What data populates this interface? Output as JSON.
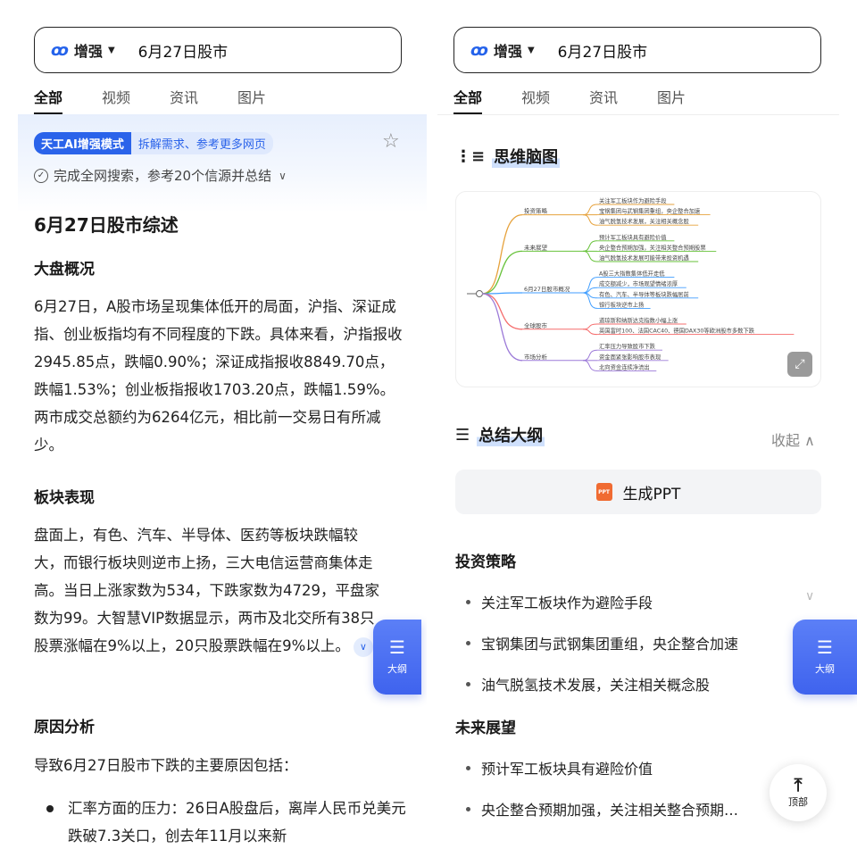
{
  "search": {
    "mode_label": "增强",
    "mode_icon": "ai-logo-icon",
    "query": "6月27日股市"
  },
  "tabs": [
    "全部",
    "视频",
    "资讯",
    "图片"
  ],
  "left": {
    "ai_badge": "天工AI增强模式",
    "ai_desc": "拆解需求、参考更多网页",
    "done_text": "完成全网搜索，参考20个信源并总结",
    "title": "6月27日股市综述",
    "sections": [
      {
        "heading": "大盘概况",
        "text": "6月27日，A股市场呈现集体低开的局面，沪指、深证成指、创业板指均有不同程度的下跌。具体来看，沪指报收2945.85点，跌幅0.90%；深证成指报收8849.70点，跌幅1.53%；创业板指报收1703.20点，跌幅1.59%。两市成交总额约为6264亿元，相比前一交易日有所减少。"
      },
      {
        "heading": "板块表现",
        "text": "盘面上，有色、汽车、半导体、医药等板块跌幅较大，而银行板块则逆市上扬，三大电信运营商集体走高。当日上涨家数为534，下跌家数为4729，平盘家数为99。大智慧VIP数据显示，两市及北交所有38只股票涨幅在9%以上，20只股票跌幅在9%以上。"
      },
      {
        "heading": "原因分析",
        "text": "导致6月27日股市下跌的主要原因包括："
      }
    ],
    "bullet": "汇率方面的压力：26日A股盘后，离岸人民币兑美元跌破7.3关口，创去年11月以来新"
  },
  "fab": {
    "outline_label": "大纲",
    "top_label": "顶部"
  },
  "right": {
    "mindmap_title": "思维脑图",
    "mindmap": {
      "root": "6月27日股市概况",
      "branches": [
        {
          "label": "投资策略",
          "leaves": [
            "关注军工板块作为避险手段",
            "宝钢集团与武钢集团重组，央企整合加速",
            "油气脱氢技术发展，关注相关概念股"
          ]
        },
        {
          "label": "未来展望",
          "leaves": [
            "预计军工板块具有避险价值",
            "央企整合预期加强，关注相关整合预期股票",
            "油气脱氢技术发展可能带来投资机遇"
          ]
        },
        {
          "label": "6月27日股市概况",
          "leaves": [
            "A股三大指数集体低开走低",
            "成交额减少，市场观望情绪浓厚",
            "有色、汽车、半导体等板块跌幅居前",
            "银行板块逆市上扬"
          ]
        },
        {
          "label": "全球股市",
          "leaves": [
            "道琼斯和纳斯达克指数小幅上涨",
            "英国富时100、法国CAC40、德国DAX30等欧洲股市多数下跌"
          ]
        },
        {
          "label": "市场分析",
          "leaves": [
            "汇率压力导致股市下跌",
            "资金面紧张影响股市表现",
            "北向资金连续净流出"
          ]
        }
      ]
    },
    "outline_title": "总结大纲",
    "collapse_label": "收起",
    "ppt_label": "生成PPT",
    "categories": [
      {
        "name": "投资策略",
        "items": [
          "关注军工板块作为避险手段",
          "宝钢集团与武钢集团重组，央企整合加速",
          "油气脱氢技术发展，关注相关概念股"
        ]
      },
      {
        "name": "未来展望",
        "items": [
          "预计军工板块具有避险价值",
          "央企整合预期加强，关注相关整合预期…"
        ]
      }
    ]
  },
  "colors": {
    "accent": "#2a63ea",
    "ppt": "#f06b32"
  }
}
